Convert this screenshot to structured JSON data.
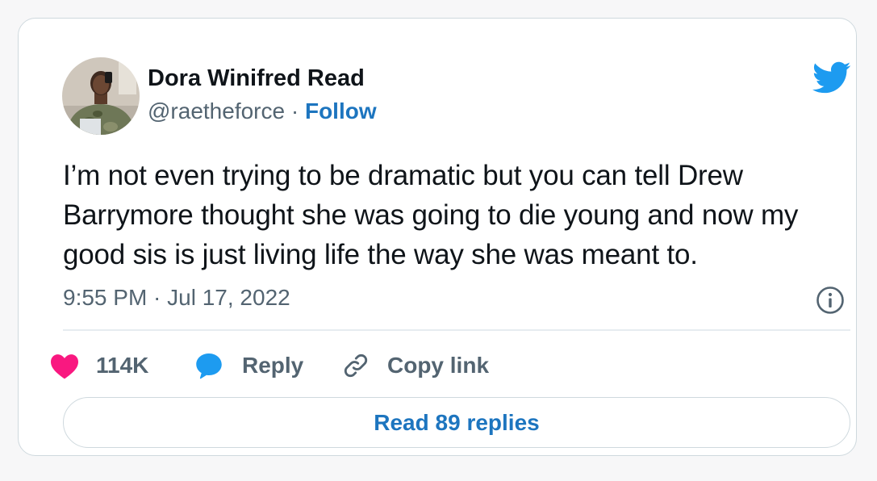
{
  "tweet": {
    "author": {
      "display_name": "Dora Winifred Read",
      "handle": "@raetheforce",
      "separator": "·",
      "follow_label": "Follow"
    },
    "text": "I’m not even trying to be dramatic but you can tell Drew Barrymore thought she was going to die young and now my good sis is just living life the way she was meant to.",
    "timestamp": "9:55 PM · Jul 17, 2022",
    "actions": {
      "like_count": "114K",
      "reply_label": "Reply",
      "copy_link_label": "Copy link"
    },
    "read_replies_label": "Read 89 replies"
  },
  "icons": {
    "brand": "twitter-bird-icon",
    "info": "info-circle-icon",
    "like": "heart-icon",
    "reply": "speech-bubble-icon",
    "copy_link": "link-icon"
  },
  "colors": {
    "accent": "#1d9bf0",
    "link": "#1d75bf",
    "like": "#f91880",
    "text": "#0f1419",
    "muted": "#536471",
    "border": "#cfd9de"
  }
}
